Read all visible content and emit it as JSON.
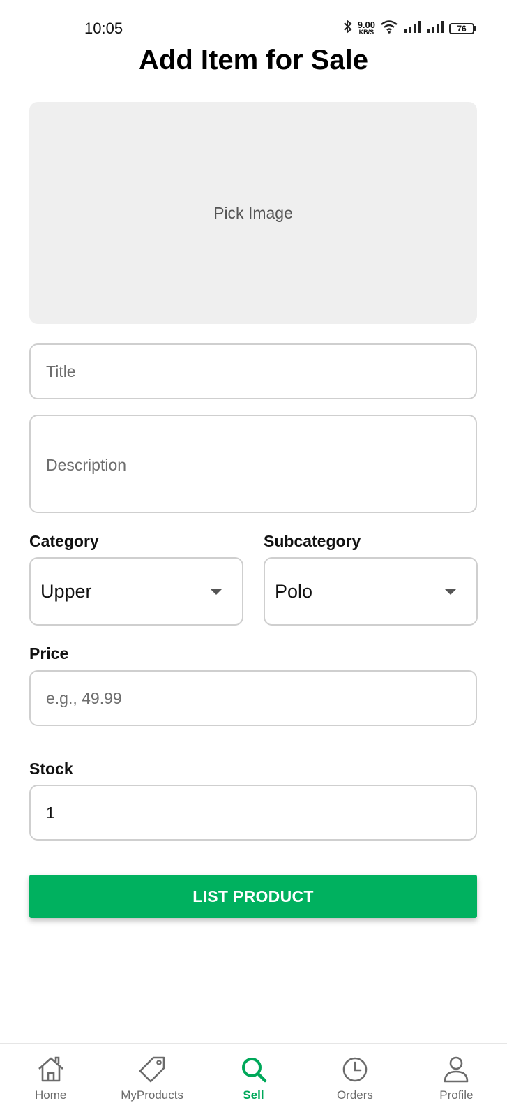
{
  "status_bar": {
    "time": "10:05",
    "net_speed_value": "9.00",
    "net_speed_unit": "KB/S",
    "battery": "76"
  },
  "page": {
    "title": "Add Item for Sale"
  },
  "image_picker": {
    "label": "Pick Image"
  },
  "form": {
    "title_placeholder": "Title",
    "description_placeholder": "Description",
    "category_label": "Category",
    "category_value": "Upper",
    "subcategory_label": "Subcategory",
    "subcategory_value": "Polo",
    "price_label": "Price",
    "price_placeholder": "e.g., 49.99",
    "stock_label": "Stock",
    "stock_value": "1",
    "submit_label": "LIST PRODUCT"
  },
  "nav": {
    "items": [
      {
        "label": "Home",
        "icon": "home-icon"
      },
      {
        "label": "MyProducts",
        "icon": "tag-icon"
      },
      {
        "label": "Sell",
        "icon": "search-icon",
        "active": true
      },
      {
        "label": "Orders",
        "icon": "clock-icon"
      },
      {
        "label": "Profile",
        "icon": "person-icon"
      }
    ]
  },
  "colors": {
    "accent": "#00b15f",
    "active_nav": "#00a85a",
    "inactive_nav": "#6b6b6b",
    "picker_bg": "#efefef",
    "border": "#cfcfcf"
  }
}
